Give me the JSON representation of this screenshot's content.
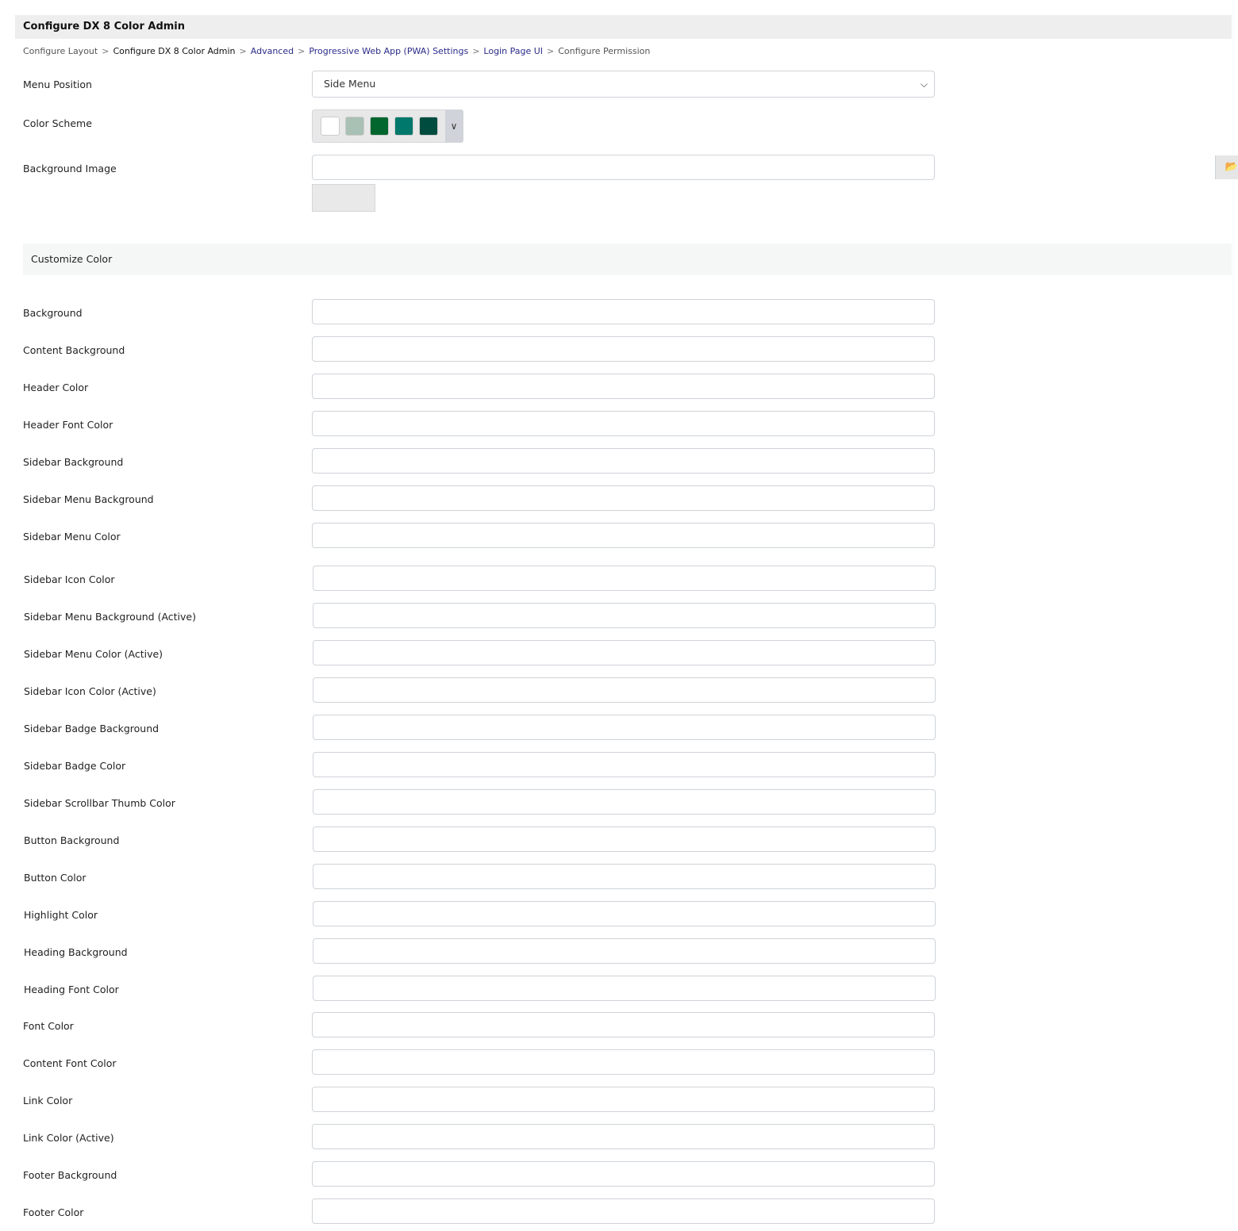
{
  "header": {
    "title": "Configure DX 8 Color Admin"
  },
  "breadcrumb": [
    {
      "label": "Configure Layout",
      "type": "plain"
    },
    {
      "label": "Configure DX 8 Color Admin",
      "type": "current"
    },
    {
      "label": "Advanced",
      "type": "link"
    },
    {
      "label": "Progressive Web App (PWA) Settings",
      "type": "link"
    },
    {
      "label": "Login Page UI",
      "type": "link"
    },
    {
      "label": "Configure Permission",
      "type": "plain"
    }
  ],
  "breadcrumb_separator": ">",
  "menu_position": {
    "label": "Menu Position",
    "value": "Side Menu"
  },
  "color_scheme": {
    "label": "Color Scheme",
    "swatches": [
      "#ffffff",
      "#a9c0b4",
      "#00662e",
      "#00786b",
      "#004d40"
    ]
  },
  "background_image": {
    "label": "Background Image",
    "value": ""
  },
  "section": {
    "title": "Customize Color"
  },
  "fields": [
    "Background",
    "Content Background",
    "Header Color",
    "Header Font Color",
    "Sidebar Background",
    "Sidebar Menu Background",
    "Sidebar Menu Color",
    "Sidebar Icon Color",
    "Sidebar Menu Background (Active)",
    "Sidebar Menu Color (Active)",
    "Sidebar Icon Color (Active)",
    "Sidebar Badge Background",
    "Sidebar Badge Color",
    "Sidebar Scrollbar Thumb Color",
    "Button Background",
    "Button Color",
    "Highlight Color",
    "Heading Background",
    "Heading Font Color",
    "Font Color",
    "Content Font Color",
    "Link Color",
    "Link Color (Active)",
    "Footer Background",
    "Footer Color"
  ]
}
